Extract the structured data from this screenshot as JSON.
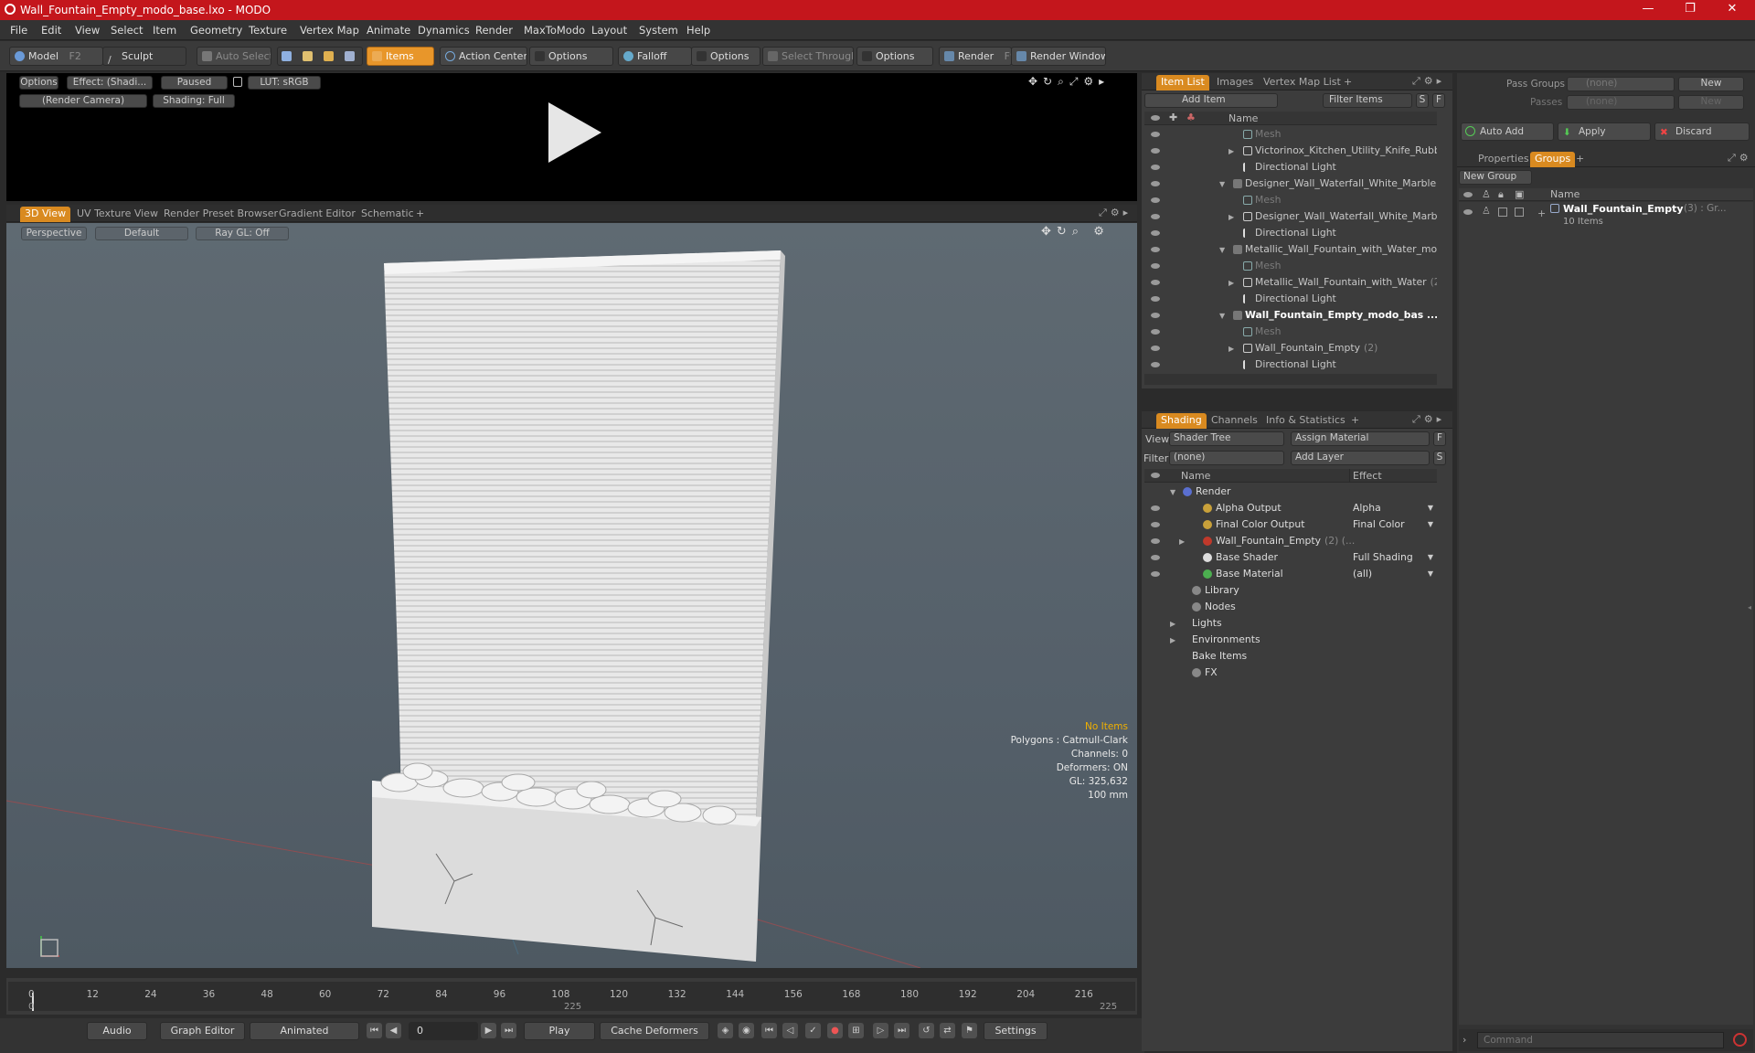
{
  "window": {
    "title": "Wall_Fountain_Empty_modo_base.lxo - MODO",
    "minimize": "—",
    "maximize": "❐",
    "close": "✕"
  },
  "menu": [
    "File",
    "Edit",
    "View",
    "Select",
    "Item",
    "Geometry",
    "Texture",
    "Vertex Map",
    "Animate",
    "Dynamics",
    "Render",
    "MaxToModo",
    "Layout",
    "System",
    "Help"
  ],
  "toolbar": {
    "model": "Model",
    "model_key": "F2",
    "sculpt": "Sculpt",
    "auto_select": "Auto Select",
    "items": "Items",
    "action_center": "Action Center",
    "options1": "Options",
    "falloff": "Falloff",
    "options2": "Options",
    "select_through": "Select Through",
    "options3": "Options",
    "render": "Render",
    "render_key": "F9",
    "render_window": "Render Window"
  },
  "render_view": {
    "options": "Options",
    "effect": "Effect: (Shadi...",
    "paused": "Paused",
    "lut": "LUT: sRGB",
    "camera": "(Render Camera)",
    "shading": "Shading: Full"
  },
  "viewport_tabs": [
    "3D View",
    "UV Texture View",
    "Render Preset Browser",
    "Gradient Editor",
    "Schematic",
    "+"
  ],
  "viewport": {
    "perspective": "Perspective",
    "default": "Default",
    "raygl": "Ray GL: Off",
    "stats": [
      "No Items",
      "Polygons : Catmull-Clark",
      "Channels: 0",
      "Deformers: ON",
      "GL: 325,632",
      "100 mm"
    ]
  },
  "item_list": {
    "tabs": [
      "Item List",
      "Images",
      "Vertex Map List",
      "+"
    ],
    "add_item": "Add Item",
    "filter_items": "Filter Items",
    "s": "S",
    "f": "F",
    "col_name": "Name",
    "rows": [
      {
        "label": "Mesh",
        "kind": "mesh",
        "indent": 2
      },
      {
        "label": "Victorinox_Kitchen_Utility_Knife_Rubb...",
        "kind": "group",
        "indent": 2
      },
      {
        "label": "Directional Light",
        "kind": "light",
        "indent": 2
      },
      {
        "label": "Designer_Wall_Waterfall_White_Marble ...",
        "kind": "scene",
        "indent": 1
      },
      {
        "label": "Mesh",
        "kind": "mesh",
        "indent": 2
      },
      {
        "label": "Designer_Wall_Waterfall_White_Marb...",
        "kind": "group",
        "indent": 2
      },
      {
        "label": "Directional Light",
        "kind": "light",
        "indent": 2
      },
      {
        "label": "Metallic_Wall_Fountain_with_Water_mo ...",
        "kind": "scene",
        "indent": 1
      },
      {
        "label": "Mesh",
        "kind": "mesh",
        "indent": 2
      },
      {
        "label": "Metallic_Wall_Fountain_with_Water",
        "suffix": "(2)",
        "kind": "group",
        "indent": 2
      },
      {
        "label": "Directional Light",
        "kind": "light",
        "indent": 2
      },
      {
        "label": "Wall_Fountain_Empty_modo_bas ...",
        "kind": "scene-bold",
        "indent": 1
      },
      {
        "label": "Mesh",
        "kind": "mesh",
        "indent": 2
      },
      {
        "label": "Wall_Fountain_Empty",
        "suffix": "(2)",
        "kind": "group",
        "indent": 2
      },
      {
        "label": "Directional Light",
        "kind": "light",
        "indent": 2
      }
    ]
  },
  "shading": {
    "tabs": [
      "Shading",
      "Channels",
      "Info & Statistics",
      "+"
    ],
    "view_label": "View",
    "view_value": "Shader Tree",
    "assign_material": "Assign Material",
    "filter_label": "Filter",
    "filter_value": "(none)",
    "add_layer": "Add Layer",
    "f": "F",
    "s": "S",
    "col_name": "Name",
    "col_effect": "Effect",
    "rows": [
      {
        "label": "Render",
        "effect": "",
        "indent": 0,
        "icon": "#5a6fd0"
      },
      {
        "label": "Alpha Output",
        "effect": "Alpha",
        "indent": 1,
        "icon": "#c9a13a"
      },
      {
        "label": "Final Color Output",
        "effect": "Final Color",
        "indent": 1,
        "icon": "#c9a13a"
      },
      {
        "label": "Wall_Fountain_Empty",
        "suffix": "(2) (...",
        "effect": "",
        "indent": 1,
        "icon": "#c0392b"
      },
      {
        "label": "Base Shader",
        "effect": "Full Shading",
        "indent": 1,
        "icon": "#dddddd"
      },
      {
        "label": "Base Material",
        "effect": "(all)",
        "indent": 1,
        "icon": "#4caf50"
      },
      {
        "label": "Library",
        "effect": "",
        "indent": 0,
        "icon": "#888888"
      },
      {
        "label": "Nodes",
        "effect": "",
        "indent": 0,
        "icon": "#888888"
      },
      {
        "label": "Lights",
        "effect": "",
        "indent": 0,
        "icon": ""
      },
      {
        "label": "Environments",
        "effect": "",
        "indent": 0,
        "icon": ""
      },
      {
        "label": "Bake Items",
        "effect": "",
        "indent": 0,
        "icon": ""
      },
      {
        "label": "FX",
        "effect": "",
        "indent": 0,
        "icon": "#888888"
      }
    ]
  },
  "groups_panel": {
    "pass_groups_label": "Pass Groups",
    "pass_groups_value": "(none)",
    "new": "New",
    "passes_label": "Passes",
    "passes_value": "(none)",
    "new2": "New",
    "auto_add": "Auto Add",
    "apply": "Apply",
    "discard": "Discard",
    "tabs": [
      "Properties",
      "Groups",
      "+"
    ],
    "new_group": "New Group",
    "col_name": "Name",
    "group_name": "Wall_Fountain_Empty",
    "group_suffix": "(3) : Gr...",
    "group_items": "10 Items"
  },
  "timeline": {
    "ticks": [
      "0",
      "12",
      "24",
      "36",
      "48",
      "60",
      "72",
      "84",
      "96",
      "108",
      "120",
      "132",
      "144",
      "156",
      "168",
      "180",
      "192",
      "204",
      "216"
    ],
    "start": "0",
    "mid": "225",
    "end": "225"
  },
  "bottom": {
    "audio": "Audio",
    "graph_editor": "Graph Editor",
    "animated": "Animated",
    "frame": "0",
    "play": "Play",
    "cache_deformers": "Cache Deformers",
    "settings": "Settings"
  },
  "command": {
    "placeholder": "Command"
  }
}
